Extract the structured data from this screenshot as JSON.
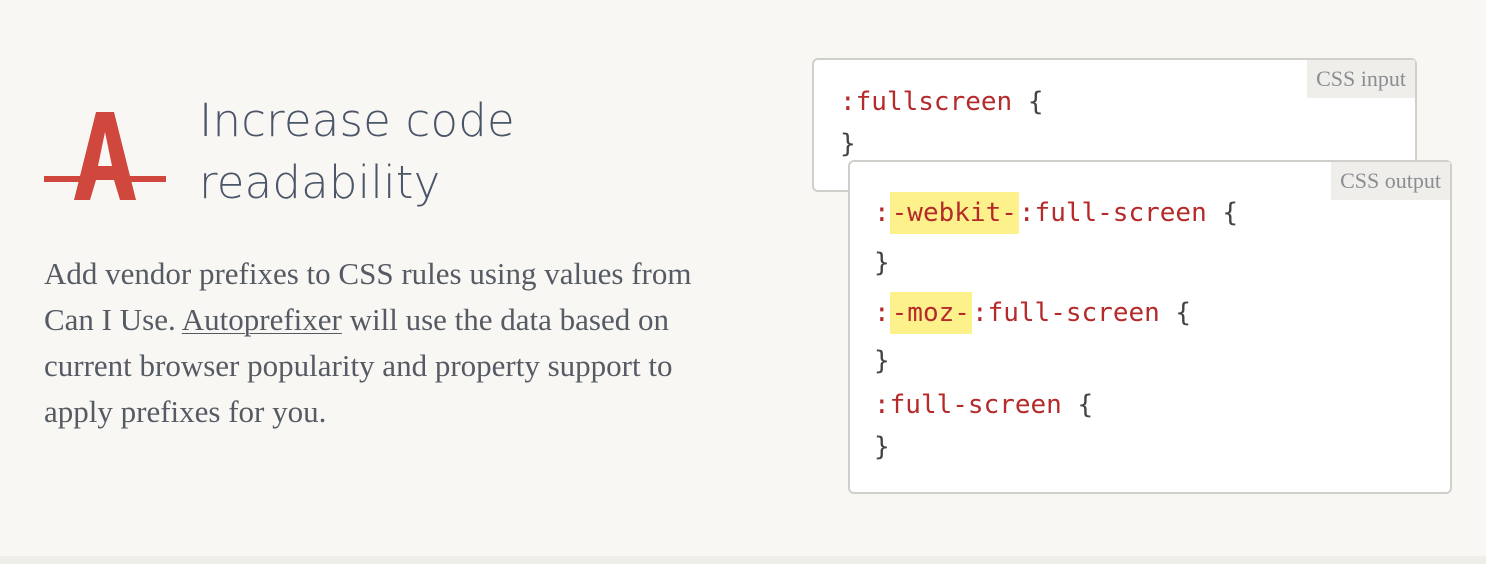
{
  "feature": {
    "title_line1": "Increase code",
    "title_line2": "readability",
    "description_before": "Add vendor prefixes to CSS rules using values from Can I Use. ",
    "description_link": "Autoprefixer",
    "description_after": " will use the data based on current browser popularity and property support to apply prefixes for you."
  },
  "colors": {
    "logo": "#d0473e",
    "selector": "#b52a2a",
    "prefix_highlight": "#fdf18b",
    "heading": "#4a5568",
    "background": "#f8f7f4"
  },
  "input_panel": {
    "label": "CSS input",
    "lines": [
      {
        "selector": ":fullscreen",
        "open": " {"
      },
      {
        "close": "}"
      }
    ]
  },
  "output_panel": {
    "label": "CSS output",
    "rules": [
      {
        "colon": ":",
        "prefix": "-webkit-",
        "rest": ":full-screen",
        "open": " {",
        "close": "}"
      },
      {
        "colon": ":",
        "prefix": "-moz-",
        "rest": ":full-screen",
        "open": " {",
        "close": "}"
      },
      {
        "colon": "",
        "prefix": "",
        "rest": ":full-screen",
        "open": " {",
        "close": "}"
      }
    ]
  },
  "icons": {
    "logo": "autoprefixer-logo-icon"
  }
}
